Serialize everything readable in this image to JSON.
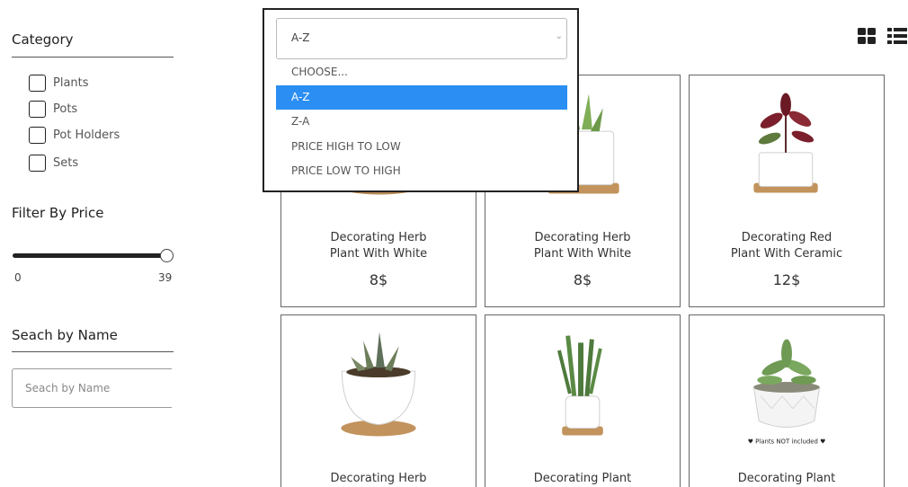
{
  "sidebar": {
    "category_heading": "Category",
    "categories": [
      {
        "label": "Plants",
        "checked": false
      },
      {
        "label": "Pots",
        "checked": false
      },
      {
        "label": "Pot Holders",
        "checked": false
      },
      {
        "label": "Sets",
        "checked": false
      }
    ],
    "price_heading": "Filter By Price",
    "price_min": "0",
    "price_max": "39",
    "price_value_fraction": 1.0,
    "name_heading": "Seach by Name",
    "name_placeholder": "Seach by Name"
  },
  "sort": {
    "selected": "A-Z",
    "options": [
      "CHOOSE...",
      "A-Z",
      "Z-A",
      "PRICE HIGH TO LOW",
      "PRICE LOW TO HIGH"
    ],
    "highlighted_index": 1
  },
  "view_toggles": {
    "grid_icon": "grid-view-icon",
    "list_icon": "list-view-icon"
  },
  "products": [
    {
      "name_line1": "Decorating Herb",
      "name_line2": "Plant With White",
      "price": "8$",
      "image": "round-pot-plant"
    },
    {
      "name_line1": "Decorating Herb",
      "name_line2": "Plant With White",
      "price": "8$",
      "image": "succulent-square-pot"
    },
    {
      "name_line1": "Decorating Red",
      "name_line2": "Plant With Ceramic",
      "price": "12$",
      "image": "red-plant-square-pot"
    },
    {
      "name_line1": "Decorating Herb",
      "name_line2": "",
      "price": "",
      "image": "succulent-round-pot"
    },
    {
      "name_line1": "Decorating Plant",
      "name_line2": "",
      "price": "",
      "image": "cactus-pot"
    },
    {
      "name_line1": "Decorating Plant",
      "name_line2": "",
      "price": "",
      "image": "succulent-geometric-pot",
      "image_caption": "♥ Plants NOT included ♥"
    }
  ],
  "colors": {
    "highlight": "#2b8ef2",
    "border": "#666666",
    "text": "#333333"
  }
}
